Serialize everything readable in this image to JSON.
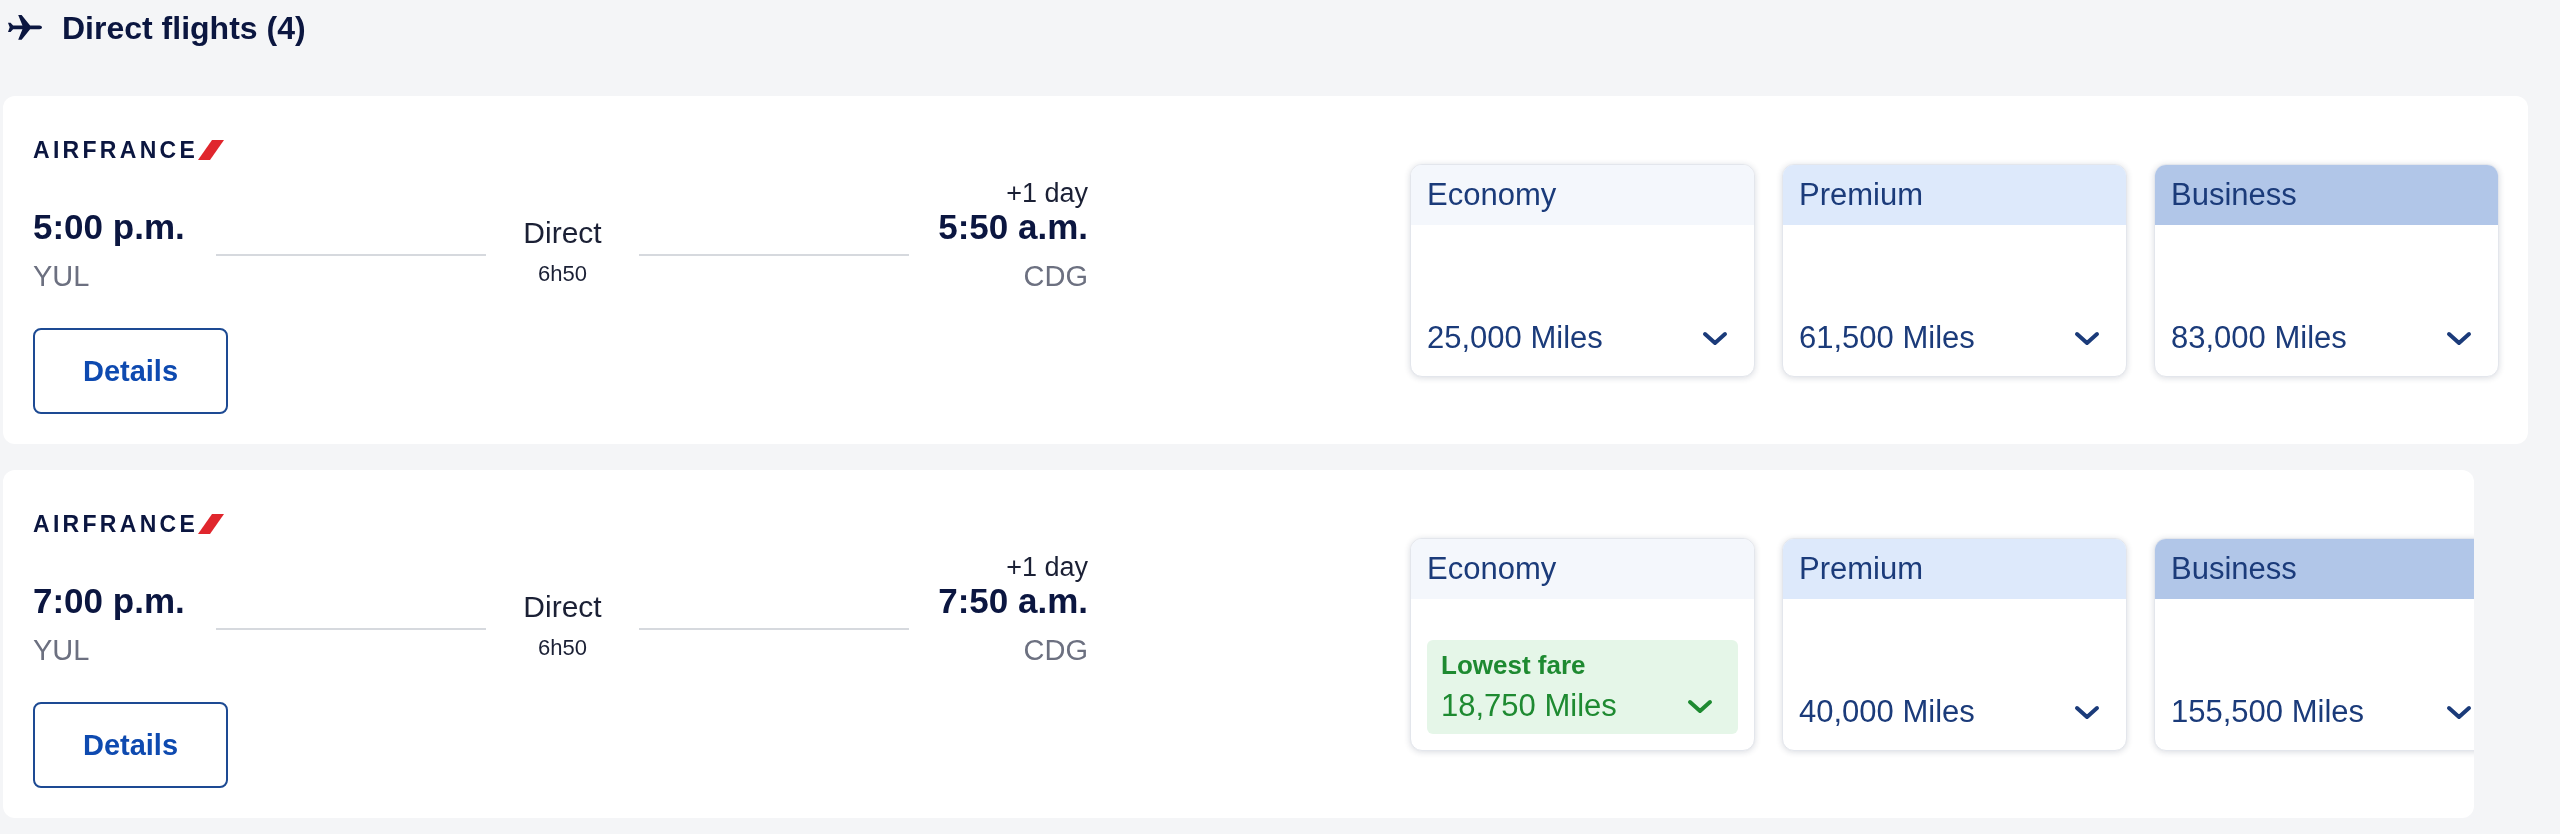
{
  "section": {
    "title": "Direct flights (4)"
  },
  "flights": [
    {
      "airline": "AIRFRANCE",
      "departure": {
        "time": "5:00 p.m.",
        "airport": "YUL"
      },
      "stops": "Direct",
      "duration": "6h50",
      "arrival": {
        "day_offset": "+1 day",
        "time": "5:50 a.m.",
        "airport": "CDG"
      },
      "details_button": "Details",
      "fares": [
        {
          "kind": "economy",
          "cabin": "Economy",
          "miles": "25,000 Miles"
        },
        {
          "kind": "premium",
          "cabin": "Premium",
          "miles": "61,500 Miles"
        },
        {
          "kind": "business",
          "cabin": "Business",
          "miles": "83,000 Miles"
        }
      ]
    },
    {
      "airline": "AIRFRANCE",
      "departure": {
        "time": "7:00 p.m.",
        "airport": "YUL"
      },
      "stops": "Direct",
      "duration": "6h50",
      "arrival": {
        "day_offset": "+1 day",
        "time": "7:50 a.m.",
        "airport": "CDG"
      },
      "details_button": "Details",
      "fares": [
        {
          "kind": "economy",
          "cabin": "Economy",
          "badge": "Lowest fare",
          "miles": "18,750 Miles"
        },
        {
          "kind": "premium",
          "cabin": "Premium",
          "miles": "40,000 Miles"
        },
        {
          "kind": "business",
          "cabin": "Business",
          "miles": "155,500 Miles"
        }
      ]
    }
  ]
}
